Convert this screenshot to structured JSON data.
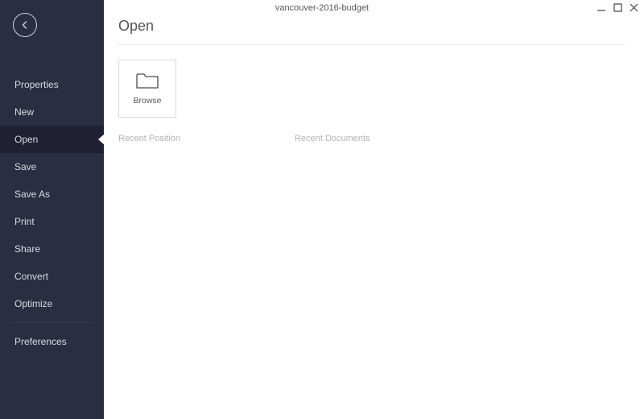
{
  "window_title": "vancouver-2016-budget",
  "sidebar": {
    "items": [
      {
        "label": "Properties",
        "active": false
      },
      {
        "label": "New",
        "active": false
      },
      {
        "label": "Open",
        "active": true
      },
      {
        "label": "Save",
        "active": false
      },
      {
        "label": "Save As",
        "active": false
      },
      {
        "label": "Print",
        "active": false
      },
      {
        "label": "Share",
        "active": false
      },
      {
        "label": "Convert",
        "active": false
      },
      {
        "label": "Optimize",
        "active": false
      }
    ],
    "preferences_label": "Preferences"
  },
  "page": {
    "title": "Open",
    "browse_label": "Browse",
    "recent_position_label": "Recent Position",
    "recent_documents_label": "Recent Documents"
  }
}
